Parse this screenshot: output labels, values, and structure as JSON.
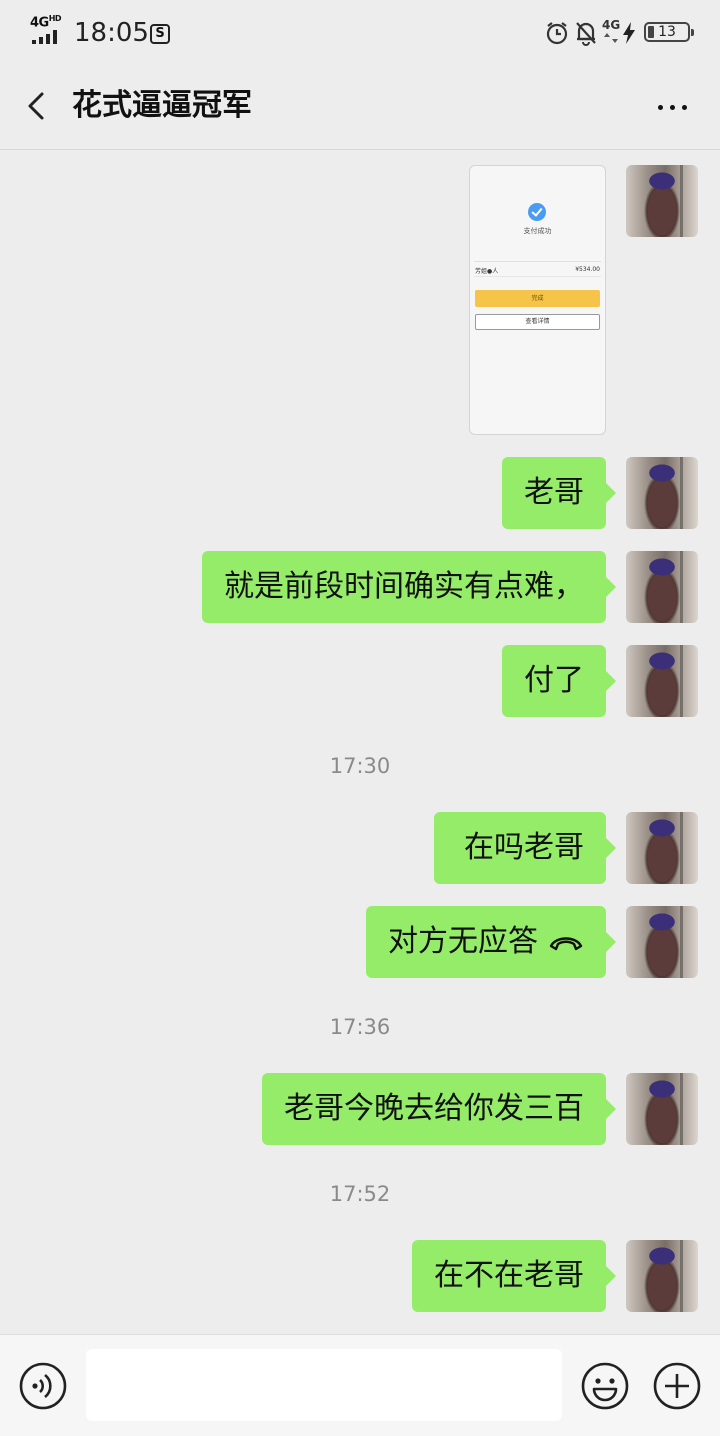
{
  "status_bar": {
    "network": "4G",
    "network_sup": "HD",
    "time": "18:05",
    "s_badge": "S",
    "right_network": "4G",
    "battery_level": "13",
    "icons": [
      "alarm-icon",
      "bell-off-icon",
      "charging-icon"
    ]
  },
  "header": {
    "title": "花式逼逼冠军",
    "back_icon": "chevron-left-icon",
    "more_icon": "more-dots-icon"
  },
  "screenshot_message": {
    "title": "支付成功",
    "merchant": "芳姐●人",
    "amount": "¥534.00",
    "primary_button": "完成",
    "secondary_button": "查看详情"
  },
  "messages": [
    {
      "text": "老哥"
    },
    {
      "text": "就是前段时间确实有点难，"
    },
    {
      "text": "付了"
    },
    {
      "timestamp": "17:30"
    },
    {
      "text": "在吗老哥"
    },
    {
      "text": "对方无应答"
    },
    {
      "timestamp": "17:36"
    },
    {
      "text": "老哥今晚去给你发三百"
    },
    {
      "timestamp": "17:52"
    },
    {
      "text": "在不在老哥"
    }
  ],
  "input_bar": {
    "placeholder": "",
    "icons": [
      "voice-icon",
      "emoji-icon",
      "plus-icon"
    ]
  },
  "colors": {
    "background": "#ededed",
    "bubble": "#95ec69",
    "timestamp": "#8a8a8a"
  }
}
